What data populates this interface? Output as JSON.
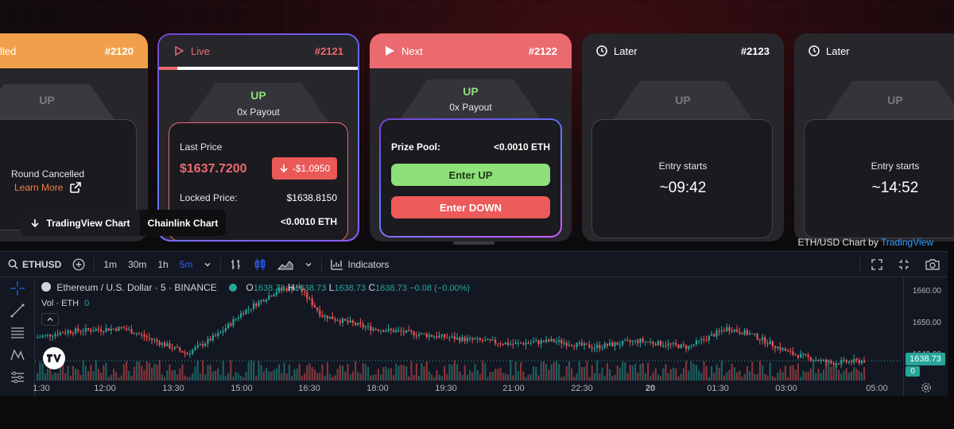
{
  "cards": {
    "c2120": {
      "status": "lled",
      "epoch": "#2120",
      "up": "UP",
      "cancel_text": "Round Cancelled",
      "learn_more": "Learn More"
    },
    "c2121": {
      "status": "Live",
      "epoch": "#2121",
      "up": "UP",
      "payout": "0x Payout",
      "last_price_label": "Last Price",
      "last_price": "$1637.7200",
      "change": "-$1.0950",
      "locked_label": "Locked Price:",
      "locked_value": "$1638.8150",
      "pool_value": "<0.0010 ETH"
    },
    "c2122": {
      "status": "Next",
      "epoch": "#2122",
      "up": "UP",
      "payout": "0x Payout",
      "prize_label": "Prize Pool:",
      "prize_value": "<0.0010 ETH",
      "enter_up": "Enter UP",
      "enter_down": "Enter DOWN"
    },
    "c2123": {
      "status": "Later",
      "epoch": "#2123",
      "up": "UP",
      "entry_label": "Entry starts",
      "entry_time": "~09:42"
    },
    "c2124": {
      "status": "Later",
      "up": "UP",
      "entry_label": "Entry starts",
      "entry_time": "~14:52"
    }
  },
  "toggle": {
    "tradingview": "TradingView Chart",
    "chainlink": "Chainlink Chart"
  },
  "credit": {
    "prefix": "ETH/USD Chart by ",
    "link": "TradingView"
  },
  "tv": {
    "symbol": "ETHUSD",
    "intervals": [
      "1m",
      "30m",
      "1h",
      "5m"
    ],
    "indicators": "Indicators",
    "title": "Ethereum / U.S. Dollar · 5 · BINANCE",
    "o_label": "O",
    "o": "1638.73",
    "h_label": "H",
    "h": "1638.73",
    "l_label": "L",
    "l": "1638.73",
    "c_label": "C",
    "c": "1638.73",
    "chg": "−0.08 (−0.00%)",
    "vol_label": "Vol · ETH",
    "vol_value": "0",
    "price_ticks": [
      "1660.00",
      "1650.00",
      "1640.00"
    ],
    "last_price": "1638.73",
    "last_vol": "0",
    "x_ticks": [
      "1:30",
      "12:00",
      "13:30",
      "15:00",
      "16:30",
      "18:00",
      "19:30",
      "21:00",
      "22:30",
      "20",
      "01:30",
      "03:00",
      "05:00"
    ]
  },
  "colors": {
    "up": "#26a69a",
    "down": "#ef5350",
    "accent": "#2962ff",
    "orange": "#f0a04b",
    "live_border": "#7645d9",
    "next_red": "#ea6a6f",
    "enter_up": "#8de07a",
    "enter_down": "#ed5a5a"
  }
}
